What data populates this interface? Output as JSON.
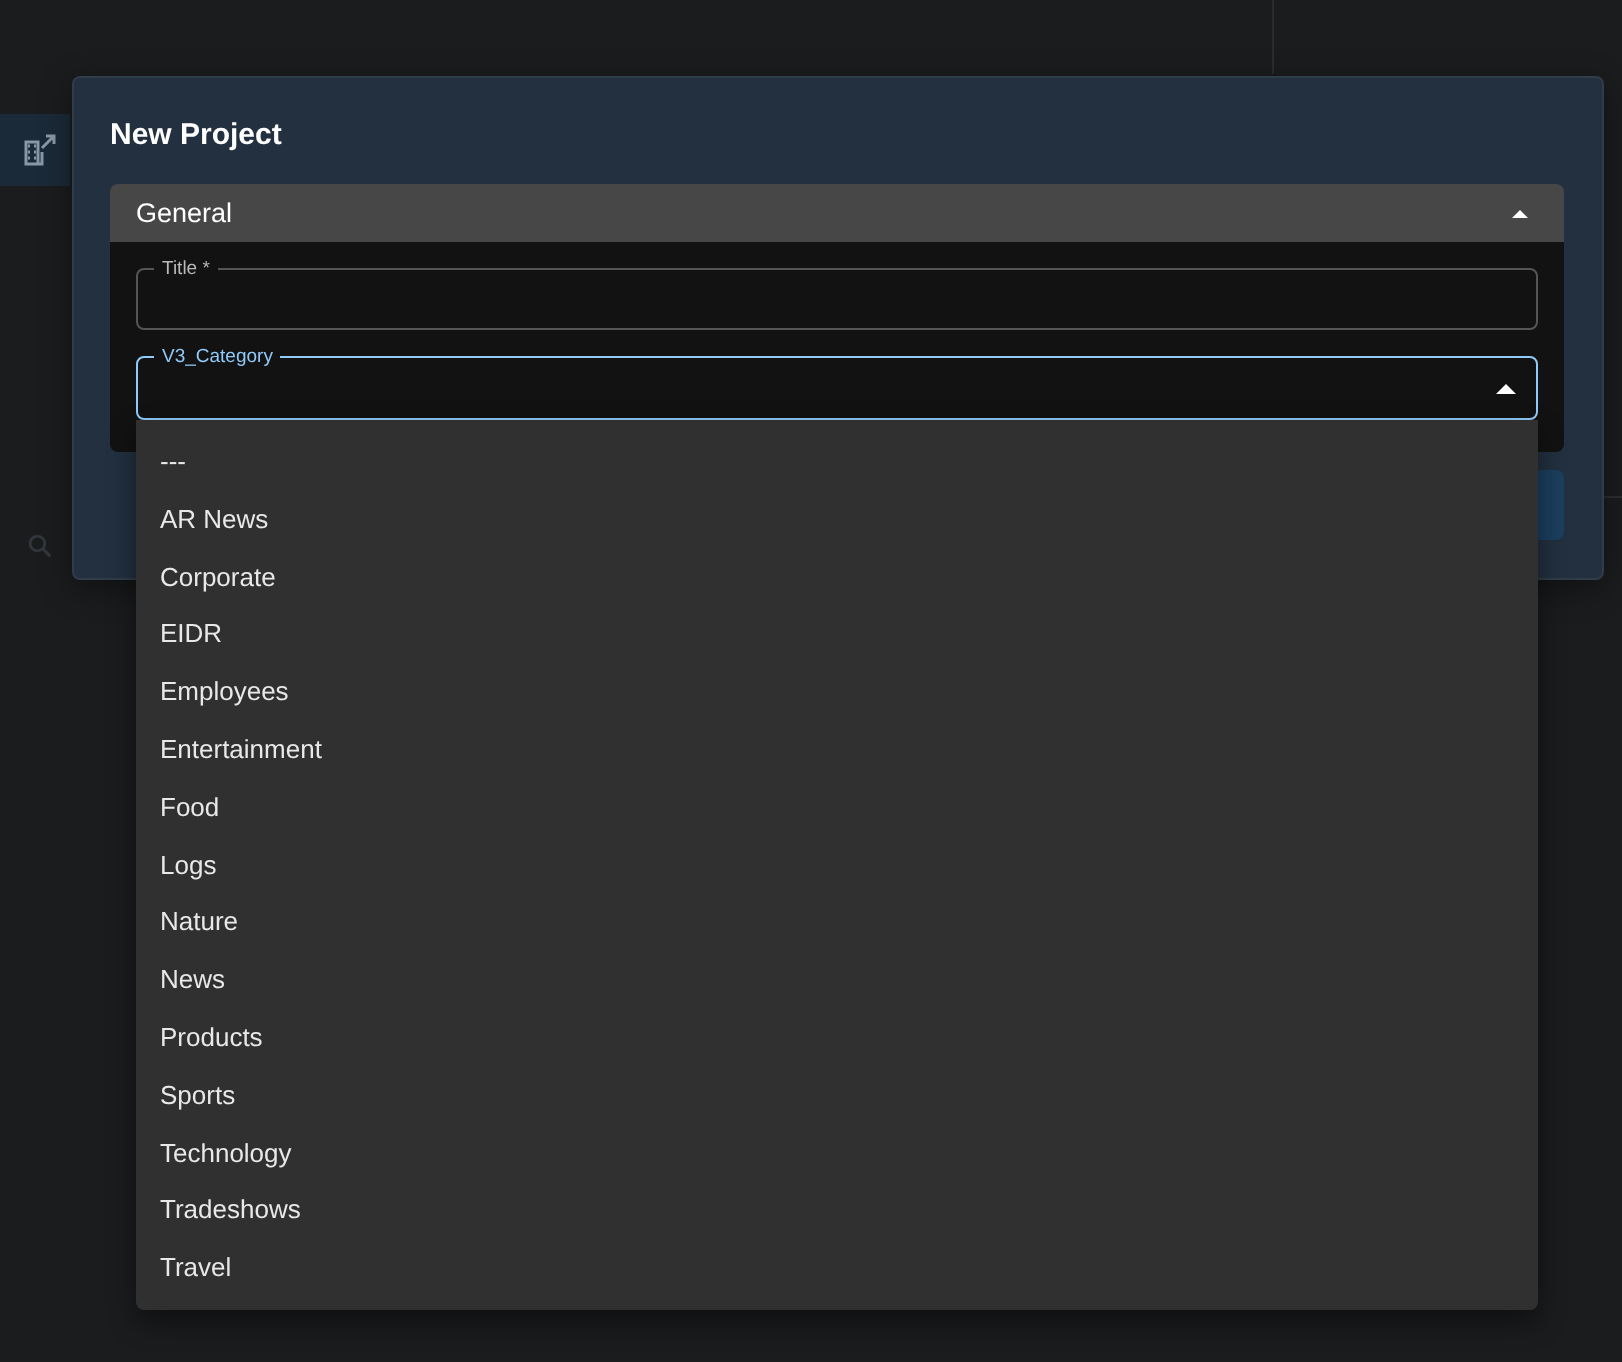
{
  "dialog": {
    "title": "New Project",
    "accordion": {
      "title": "General",
      "expanded": true,
      "fields": [
        {
          "kind": "text",
          "label": "Title *"
        },
        {
          "kind": "select",
          "label": "V3_Category",
          "open": true,
          "options": [
            {
              "label": "---",
              "selected": false
            },
            {
              "label": "AR News",
              "selected": false
            },
            {
              "label": "Corporate",
              "selected": false
            },
            {
              "label": "EIDR",
              "selected": false
            },
            {
              "label": "Employees",
              "selected": false
            },
            {
              "label": "Entertainment",
              "selected": false
            },
            {
              "label": "Food",
              "selected": false
            },
            {
              "label": "Logs",
              "selected": false
            },
            {
              "label": "Nature",
              "selected": false
            },
            {
              "label": "News",
              "selected": false
            },
            {
              "label": "Products",
              "selected": false
            },
            {
              "label": "Sports",
              "selected": false
            },
            {
              "label": "Technology",
              "selected": false
            },
            {
              "label": "Tradeshows",
              "selected": false
            },
            {
              "label": "Travel",
              "selected": false
            }
          ]
        }
      ]
    }
  }
}
